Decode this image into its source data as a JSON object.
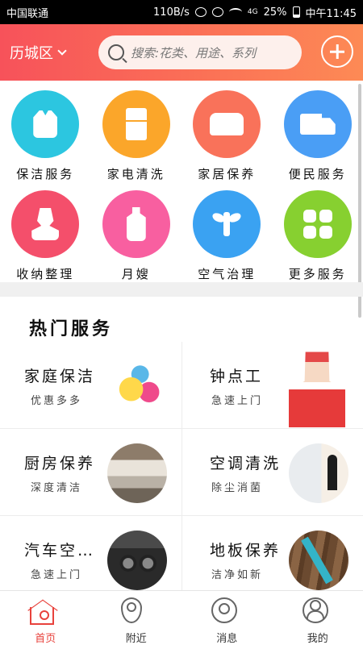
{
  "status_bar": {
    "carrier": "中国联通",
    "speed": "110B/s",
    "network": "4G",
    "battery": "25%",
    "time": "中午11:45"
  },
  "header": {
    "city": "历城区",
    "search_placeholder": "搜索:花类、用途、系列"
  },
  "categories": [
    {
      "label": "保洁服务",
      "icon": "vest-icon",
      "color": "#2cc6e0"
    },
    {
      "label": "家电清洗",
      "icon": "fridge-icon",
      "color": "#fba62a"
    },
    {
      "label": "家居保养",
      "icon": "sofa-icon",
      "color": "#f9725a"
    },
    {
      "label": "便民服务",
      "icon": "truck-icon",
      "color": "#4a9ef5"
    },
    {
      "label": "收纳整理",
      "icon": "person-icon",
      "color": "#f44f6b"
    },
    {
      "label": "月嫂",
      "icon": "bottle-icon",
      "color": "#f85fa0"
    },
    {
      "label": "空气治理",
      "icon": "sprout-icon",
      "color": "#3aa2f2"
    },
    {
      "label": "更多服务",
      "icon": "grid-icon",
      "color": "#87d030"
    }
  ],
  "hot": {
    "title": "热门服务",
    "items": [
      {
        "title": "家庭保洁",
        "subtitle": "优惠多多",
        "image": "cleaning-supplies-image"
      },
      {
        "title": "钟点工",
        "subtitle": "急速上门",
        "image": "housekeeper-image"
      },
      {
        "title": "厨房保养",
        "subtitle": "深度清洁",
        "image": "kitchen-image"
      },
      {
        "title": "空调清洗",
        "subtitle": "除尘消菌",
        "image": "air-conditioner-image"
      },
      {
        "title": "汽车空…",
        "subtitle": "急速上门",
        "image": "car-interior-image"
      },
      {
        "title": "地板保养",
        "subtitle": "洁净如新",
        "image": "wood-floor-image"
      }
    ]
  },
  "bottom_nav": [
    {
      "label": "首页",
      "icon": "home-icon",
      "active": true
    },
    {
      "label": "附近",
      "icon": "location-icon",
      "active": false
    },
    {
      "label": "消息",
      "icon": "message-icon",
      "active": false
    },
    {
      "label": "我的",
      "icon": "user-icon",
      "active": false
    }
  ],
  "colors": {
    "header_start": "#f7525a",
    "header_end": "#fd8a55",
    "accent": "#e8423c"
  }
}
